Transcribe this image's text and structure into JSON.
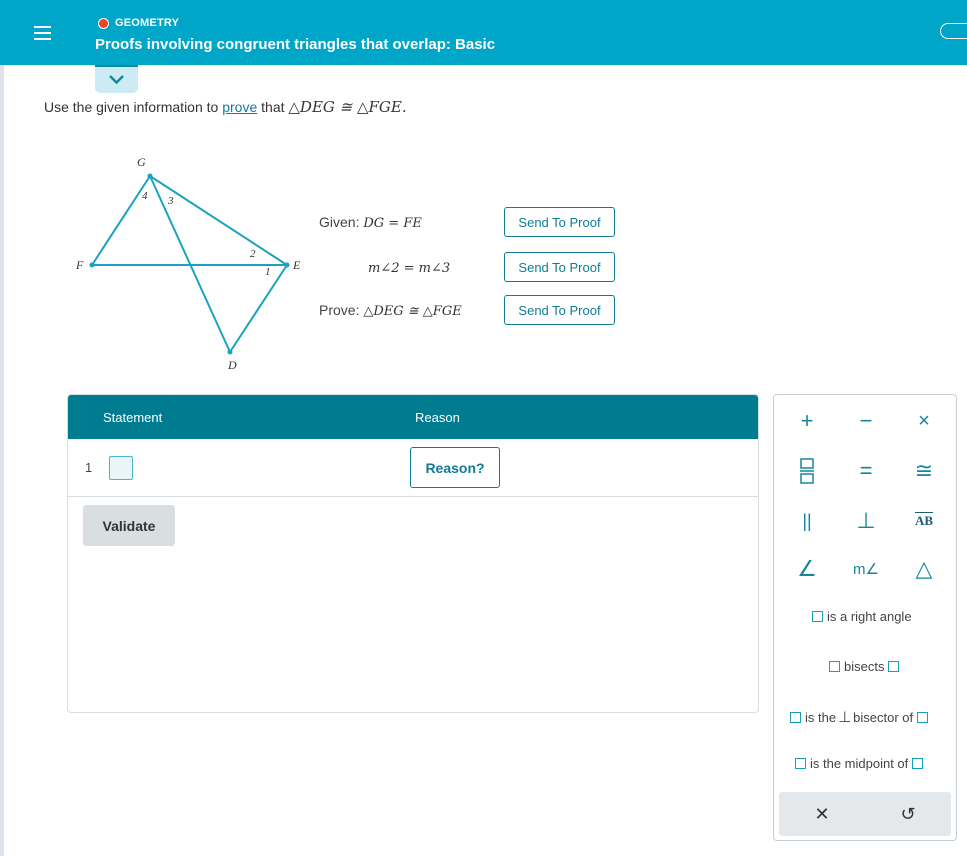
{
  "header": {
    "topic": "GEOMETRY",
    "title": "Proofs involving congruent triangles that overlap: Basic"
  },
  "prompt": {
    "prefix": "Use the given information to",
    "link": "prove",
    "middle": "that",
    "statement": "△DEG ≅ △FGE."
  },
  "figure": {
    "points": {
      "G": "G",
      "F": "F",
      "E": "E",
      "D": "D"
    },
    "angles": {
      "a1": "1",
      "a2": "2",
      "a3": "3",
      "a4": "4"
    }
  },
  "given": {
    "given_label": "Given:",
    "given_1": "DG = FE",
    "given_2": "m∠2 = m∠3",
    "prove_label": "Prove:",
    "prove": "△DEG ≅ △FGE",
    "send_label": "Send To Proof"
  },
  "proof": {
    "col_statement": "Statement",
    "col_reason": "Reason",
    "rows": [
      {
        "number": "1",
        "reason_label": "Reason?"
      }
    ],
    "validate_label": "Validate"
  },
  "palette": {
    "plus": "+",
    "minus": "−",
    "times": "×",
    "equals": "=",
    "congruent": "≅",
    "parallel": "||",
    "perpendicular": "⊥",
    "segment": "AB",
    "angle": "∠",
    "measure_angle": "m∠",
    "triangle": "△",
    "right_angle_text": "is a right angle",
    "bisects_text": "bisects",
    "perp_bisector_a": "is the",
    "perp_bisector_b": "bisector of",
    "midpoint_text": "is the midpoint of",
    "clear": "✕",
    "undo": "↺"
  },
  "colors": {
    "header": "#00a6c8",
    "accent": "#0e7c92",
    "table_header": "#007c91"
  }
}
